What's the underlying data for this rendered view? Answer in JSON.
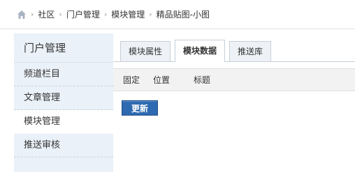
{
  "breadcrumb": {
    "home_icon": "home-icon",
    "items": [
      "社区",
      "门户管理",
      "模块管理",
      "精品贴图-小图"
    ]
  },
  "sidebar": {
    "title": "门户管理",
    "items": [
      {
        "label": "频道栏目",
        "active": false
      },
      {
        "label": "文章管理",
        "active": false
      },
      {
        "label": "模块管理",
        "active": true
      },
      {
        "label": "推送审核",
        "active": false
      }
    ]
  },
  "tabs": [
    {
      "label": "模块属性",
      "active": false
    },
    {
      "label": "模块数据",
      "active": true
    },
    {
      "label": "推送库",
      "active": false
    }
  ],
  "table": {
    "columns": [
      "固定",
      "位置",
      "标题"
    ]
  },
  "actions": {
    "update_label": "更新"
  },
  "colors": {
    "sidebar_bg": "#eaf1f8",
    "button_bg": "#2e6ab1"
  }
}
